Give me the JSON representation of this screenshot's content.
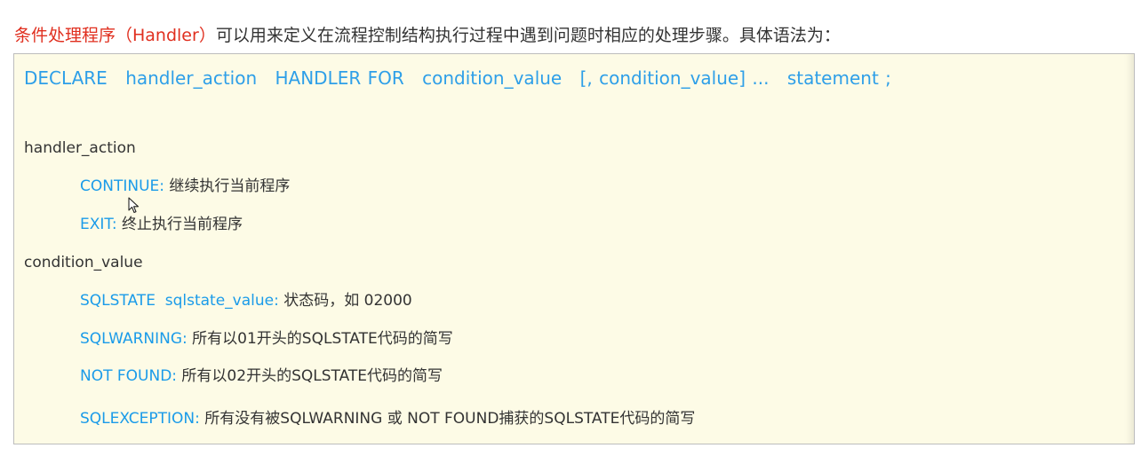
{
  "intro": {
    "highlight": "条件处理程序（Handler）",
    "rest": "可以用来定义在流程控制结构执行过程中遇到问题时相应的处理步骤。具体语法为："
  },
  "syntax": {
    "parts": [
      "DECLARE",
      "handler_action",
      "HANDLER FOR",
      "condition_value",
      "[, condition_value] ...",
      "statement ;"
    ]
  },
  "handler_action": {
    "heading": "handler_action",
    "items": [
      {
        "keyword": "CONTINUE:",
        "desc": " 继续执行当前程序"
      },
      {
        "keyword": "EXIT:",
        "desc": " 终止执行当前程序"
      }
    ]
  },
  "condition_value": {
    "heading": "condition_value",
    "items": [
      {
        "keyword": "SQLSTATE  sqlstate_value:",
        "desc": " 状态码，如 02000"
      },
      {
        "keyword": "SQLWARNING:",
        "desc": " 所有以01开头的SQLSTATE代码的简写"
      },
      {
        "keyword": "NOT FOUND:",
        "desc": " 所有以02开头的SQLSTATE代码的简写"
      },
      {
        "keyword": "SQLEXCEPTION:",
        "desc": " 所有没有被SQLWARNING 或 NOT FOUND捕获的SQLSTATE代码的简写"
      }
    ]
  },
  "colors": {
    "highlight_red": "#e02f1f",
    "keyword_blue": "#1a9be9",
    "box_background": "#fdfbe6",
    "text": "#333333"
  },
  "icons": {
    "cursor": "mouse-pointer-icon"
  }
}
